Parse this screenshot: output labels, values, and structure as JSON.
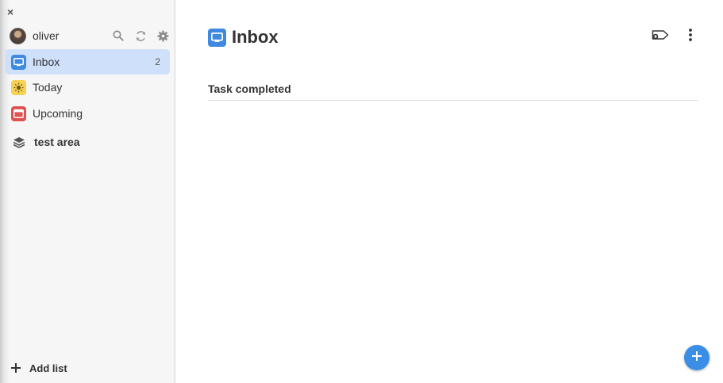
{
  "window": {
    "close_label": "×"
  },
  "user": {
    "name": "oliver"
  },
  "sidebar": {
    "items": [
      {
        "label": "Inbox",
        "count": "2",
        "icon": "inbox-icon",
        "color": "#3f8ae0"
      },
      {
        "label": "Today",
        "icon": "sun-icon",
        "color": "#f6d155"
      },
      {
        "label": "Upcoming",
        "icon": "calendar-icon",
        "color": "#e05252"
      },
      {
        "label": "test area",
        "icon": "layers-icon"
      }
    ],
    "add_list_label": "Add list"
  },
  "main": {
    "title": "Inbox",
    "section_header": "Task completed"
  },
  "colors": {
    "accent": "#3a8ee6",
    "active_bg": "#cfe0fb"
  }
}
